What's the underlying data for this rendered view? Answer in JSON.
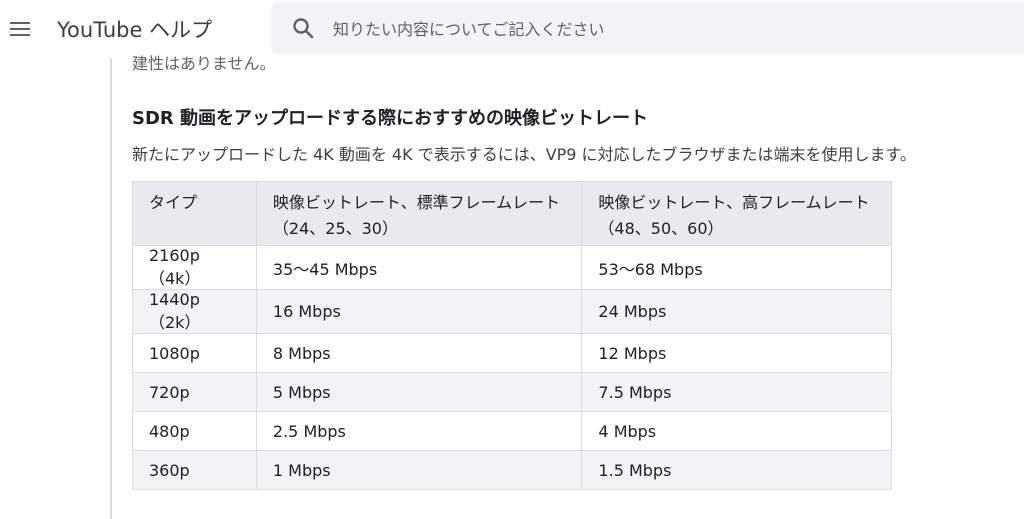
{
  "header": {
    "app_title": "YouTube ヘルプ",
    "search_placeholder": "知りたい内容についてご記入ください",
    "menu_icon": "hamburger-menu-icon",
    "search_icon": "search-icon"
  },
  "article": {
    "cutoff_text": "建性はありません。",
    "section_heading": "SDR 動画をアップロードする際におすすめの映像ビットレート",
    "section_description": "新たにアップロードした 4K 動画を 4K で表示するには、VP9 に対応したブラウザまたは端末を使用します。",
    "table": {
      "headers": {
        "type": "タイプ",
        "standard_line1": "映像ビットレート、標準フレームレート",
        "standard_line2": "（24、25、30）",
        "high_line1": "映像ビットレート、高フレームレート",
        "high_line2": "（48、50、60）"
      },
      "rows": [
        {
          "type": "2160p（4k）",
          "standard": "35～45 Mbps",
          "high": "53～68 Mbps"
        },
        {
          "type": "1440p（2k）",
          "standard": "16 Mbps",
          "high": "24 Mbps"
        },
        {
          "type": "1080p",
          "standard": "8 Mbps",
          "high": "12 Mbps"
        },
        {
          "type": "720p",
          "standard": "5 Mbps",
          "high": "7.5 Mbps"
        },
        {
          "type": "480p",
          "standard": "2.5 Mbps",
          "high": "4 Mbps"
        },
        {
          "type": "360p",
          "standard": "1 Mbps",
          "high": "1.5 Mbps"
        }
      ]
    }
  },
  "colors": {
    "header_bg": "#ffffff",
    "search_bg": "#f1f3f4",
    "table_header_bg": "#e8eaed",
    "table_alt_row_bg": "#f1f3f4",
    "border": "#dadce0",
    "text": "#202124"
  }
}
